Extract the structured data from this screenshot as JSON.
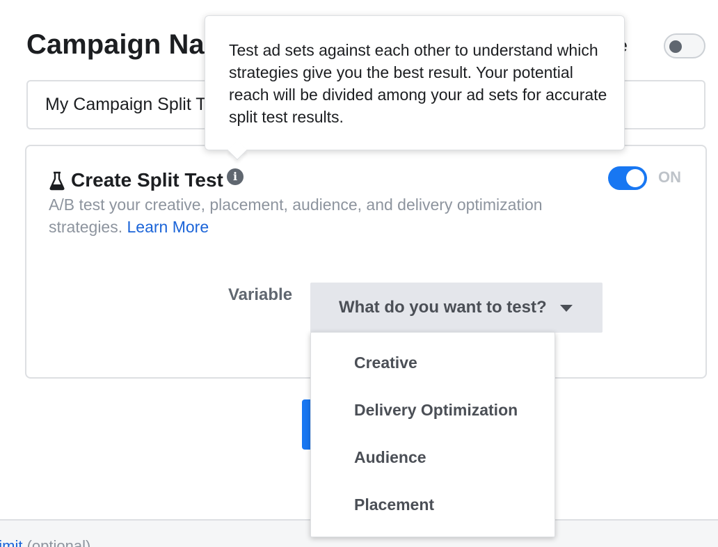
{
  "header": {
    "campaign_title": "Campaign Na",
    "template_label": "late"
  },
  "campaign_name": {
    "value": "My Campaign Split T"
  },
  "split_test": {
    "title": "Create Split Test",
    "info_glyph": "i",
    "description": "A/B test your creative, placement, audience, and delivery optimization strategies. ",
    "learn_more": "Learn More",
    "toggle_state": "ON",
    "toggle_on": true
  },
  "variable": {
    "label": "Variable",
    "placeholder": "What do you want to test?",
    "options": [
      "Creative",
      "Delivery Optimization",
      "Audience",
      "Placement"
    ]
  },
  "tooltip": {
    "text": "Test ad sets against each other to understand which strategies give you the best result. Your potential reach will be divided among your ad sets for accurate split test results."
  },
  "footer": {
    "link_text": "Limit",
    "hint_text": " (optional)"
  },
  "colors": {
    "accent": "#1877f2",
    "link": "#1b64d8",
    "muted_text": "#8d949e"
  }
}
